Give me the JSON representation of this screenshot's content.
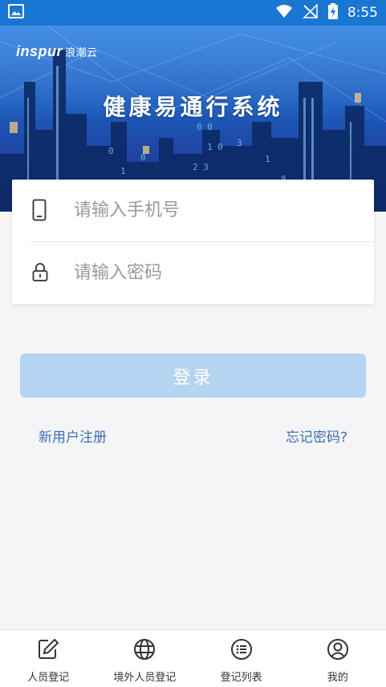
{
  "status_bar": {
    "time": "8:55"
  },
  "banner": {
    "brand_en": "inspur",
    "brand_cn": "浪潮云",
    "title": "健康易通行系统"
  },
  "login_form": {
    "phone_placeholder": "请输入手机号",
    "password_placeholder": "请输入密码"
  },
  "login_button": "登录",
  "links": {
    "register": "新用户注册",
    "forgot": "忘记密码?"
  },
  "bottom_nav": [
    {
      "label": "人员登记",
      "icon": "edit-icon"
    },
    {
      "label": "境外人员登记",
      "icon": "globe-icon"
    },
    {
      "label": "登记列表",
      "icon": "list-icon"
    },
    {
      "label": "我的",
      "icon": "user-icon"
    }
  ],
  "colors": {
    "status_bar": "#1976d2",
    "button_disabled": "#b5d4f1",
    "link": "#3c6fb5"
  }
}
